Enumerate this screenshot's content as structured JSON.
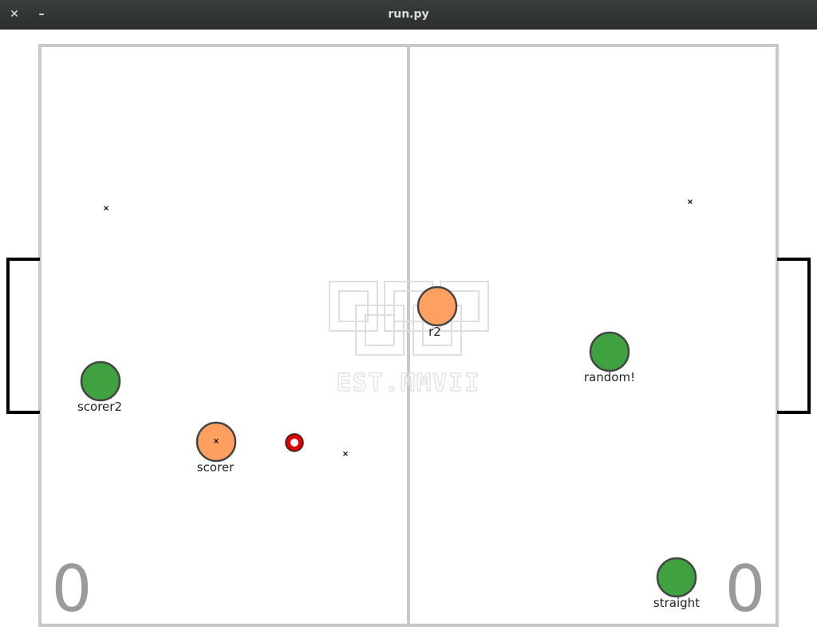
{
  "window": {
    "title": "run.py",
    "close_glyph": "✕",
    "minimize_glyph": "–"
  },
  "colors": {
    "field_line": "#c8c8c8",
    "goal": "#000000",
    "team_orange": "#ffa060",
    "team_green": "#3fa13f",
    "ball_red": "#e00000",
    "score": "#9a9a9a"
  },
  "scores": {
    "left": "0",
    "right": "0"
  },
  "logo": {
    "text": "EST.MMVII"
  },
  "players": [
    {
      "id": "p-orange-2",
      "team": "orange",
      "label": "r2",
      "marker": false
    },
    {
      "id": "p-orange-scorer",
      "team": "orange",
      "label": "scorer",
      "marker": true
    },
    {
      "id": "p-green-scorer2",
      "team": "green",
      "label": "scorer2",
      "marker": false
    },
    {
      "id": "p-green-random",
      "team": "green",
      "label": "random!",
      "marker": false
    },
    {
      "id": "p-green-straight",
      "team": "green",
      "label": "straight",
      "marker": false
    }
  ],
  "ball": {
    "icon": "ball-icon"
  }
}
